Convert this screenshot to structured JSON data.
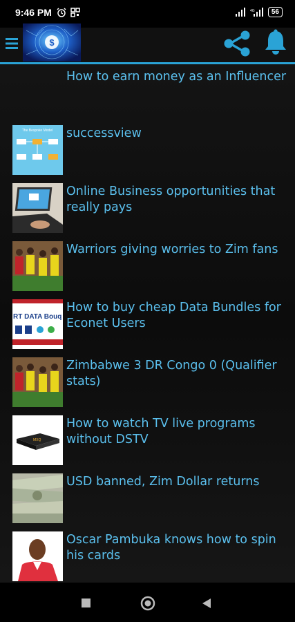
{
  "status": {
    "time": "9:46 PM",
    "battery": "56"
  },
  "header": {
    "menu_icon": "hamburger-menu-icon",
    "logo_text": "$",
    "share_icon": "share-icon",
    "bell_icon": "bell-icon"
  },
  "featured_title": "How to earn money as an Influencer",
  "articles": [
    {
      "title": "successview",
      "thumb": "diagram"
    },
    {
      "title": "Online Business opportunities that really pays",
      "thumb": "laptop"
    },
    {
      "title": "Warriors giving worries to Zim fans",
      "thumb": "football"
    },
    {
      "title": "How to buy cheap Data Bundles for Econet Users",
      "thumb": "data-banner"
    },
    {
      "title": "Zimbabwe 3 DR Congo 0 (Qualifier stats)",
      "thumb": "football"
    },
    {
      "title": "How to watch TV live programs without DSTV",
      "thumb": "tv-box"
    },
    {
      "title": "USD banned, Zim Dollar returns",
      "thumb": "money"
    },
    {
      "title": "Oscar Pambuka knows how to spin his cards",
      "thumb": "person"
    }
  ],
  "thumb_text": {
    "diagram_heading": "The Bespoke Model",
    "data_banner": "RT DATA Bouq",
    "tv_brand": "MXQ"
  },
  "colors": {
    "accent": "#5bc0ee",
    "accent_line": "#2aa3d6",
    "background": "#000000"
  }
}
